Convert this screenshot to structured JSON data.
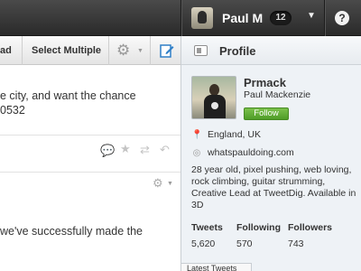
{
  "topbar": {
    "username": "Paul M",
    "notification_count": "12",
    "caret": "▼",
    "help_label": "?"
  },
  "toolbar": {
    "partial_button_label": "ad",
    "select_multiple_label": "Select Multiple",
    "gear_glyph": "⚙",
    "caret": "▼"
  },
  "main": {
    "tweet1_line1": "e city, and want the chance",
    "tweet1_line2": "0532",
    "tweet2_line1": "we've successfully made the"
  },
  "profile": {
    "panel_title": "Profile",
    "screen_name": "Prmack",
    "full_name": "Paul Mackenzie",
    "follow_label": "Follow",
    "location": "England, UK",
    "website": "whatspauldoing.com",
    "bio": "28 year old, pixel pushing, web loving, rock climbing, guitar strumming, Creative Lead at TweetDig. Available in 3D",
    "stats": [
      {
        "label": "Tweets",
        "value": "5,620"
      },
      {
        "label": "Following",
        "value": "570"
      },
      {
        "label": "Followers",
        "value": "743"
      }
    ],
    "latest_tab_label": "Latest Tweets"
  },
  "icons": {
    "location": "location-pin-icon",
    "website": "globe-icon"
  }
}
